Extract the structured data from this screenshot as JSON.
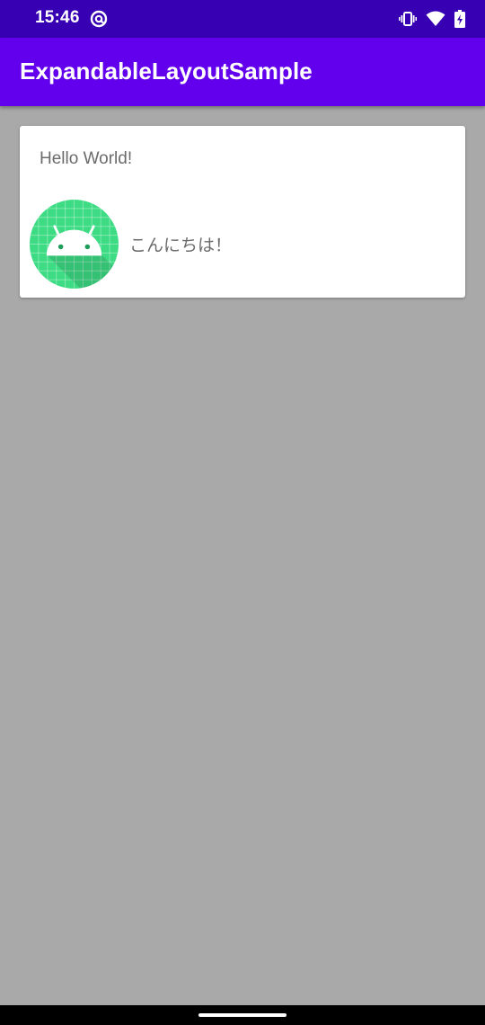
{
  "status_bar": {
    "time": "15:46",
    "left_icon": "at-sign-icon",
    "right_icons": [
      "vibrate-icon",
      "wifi-icon",
      "battery-charging-icon"
    ],
    "background": "#3700b3"
  },
  "app_bar": {
    "title": "ExpandableLayoutSample",
    "background": "#6200ee"
  },
  "card": {
    "title": "Hello World!",
    "avatar_icon": "android-robot-icon",
    "body_text": "こんにちは！"
  },
  "colors": {
    "screen_background": "#a9a9a9",
    "card_background": "#ffffff",
    "text_gray": "#6b6b6b",
    "avatar_green": "#3ddc84"
  },
  "navigation": {
    "gesture_handle": "home-gesture-handle"
  }
}
